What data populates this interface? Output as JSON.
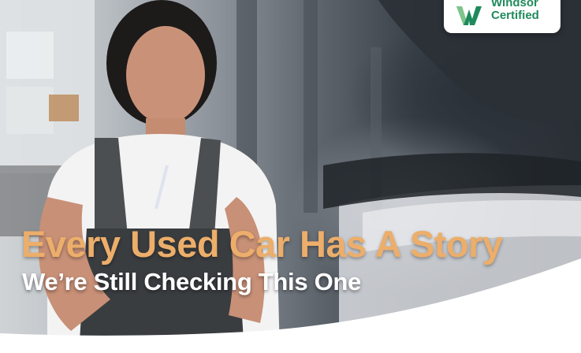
{
  "badge": {
    "brand_line1": "Windsor",
    "brand_line2": "Certified",
    "logo_icon": "windsor-w-logo-icon",
    "brand_color": "#1f8a5b"
  },
  "hero": {
    "headline": "Every Used Car Has A Story",
    "subheadline": "We’re Still Checking This One",
    "headline_color": "#ecae6a",
    "subheadline_color": "#ffffff"
  }
}
